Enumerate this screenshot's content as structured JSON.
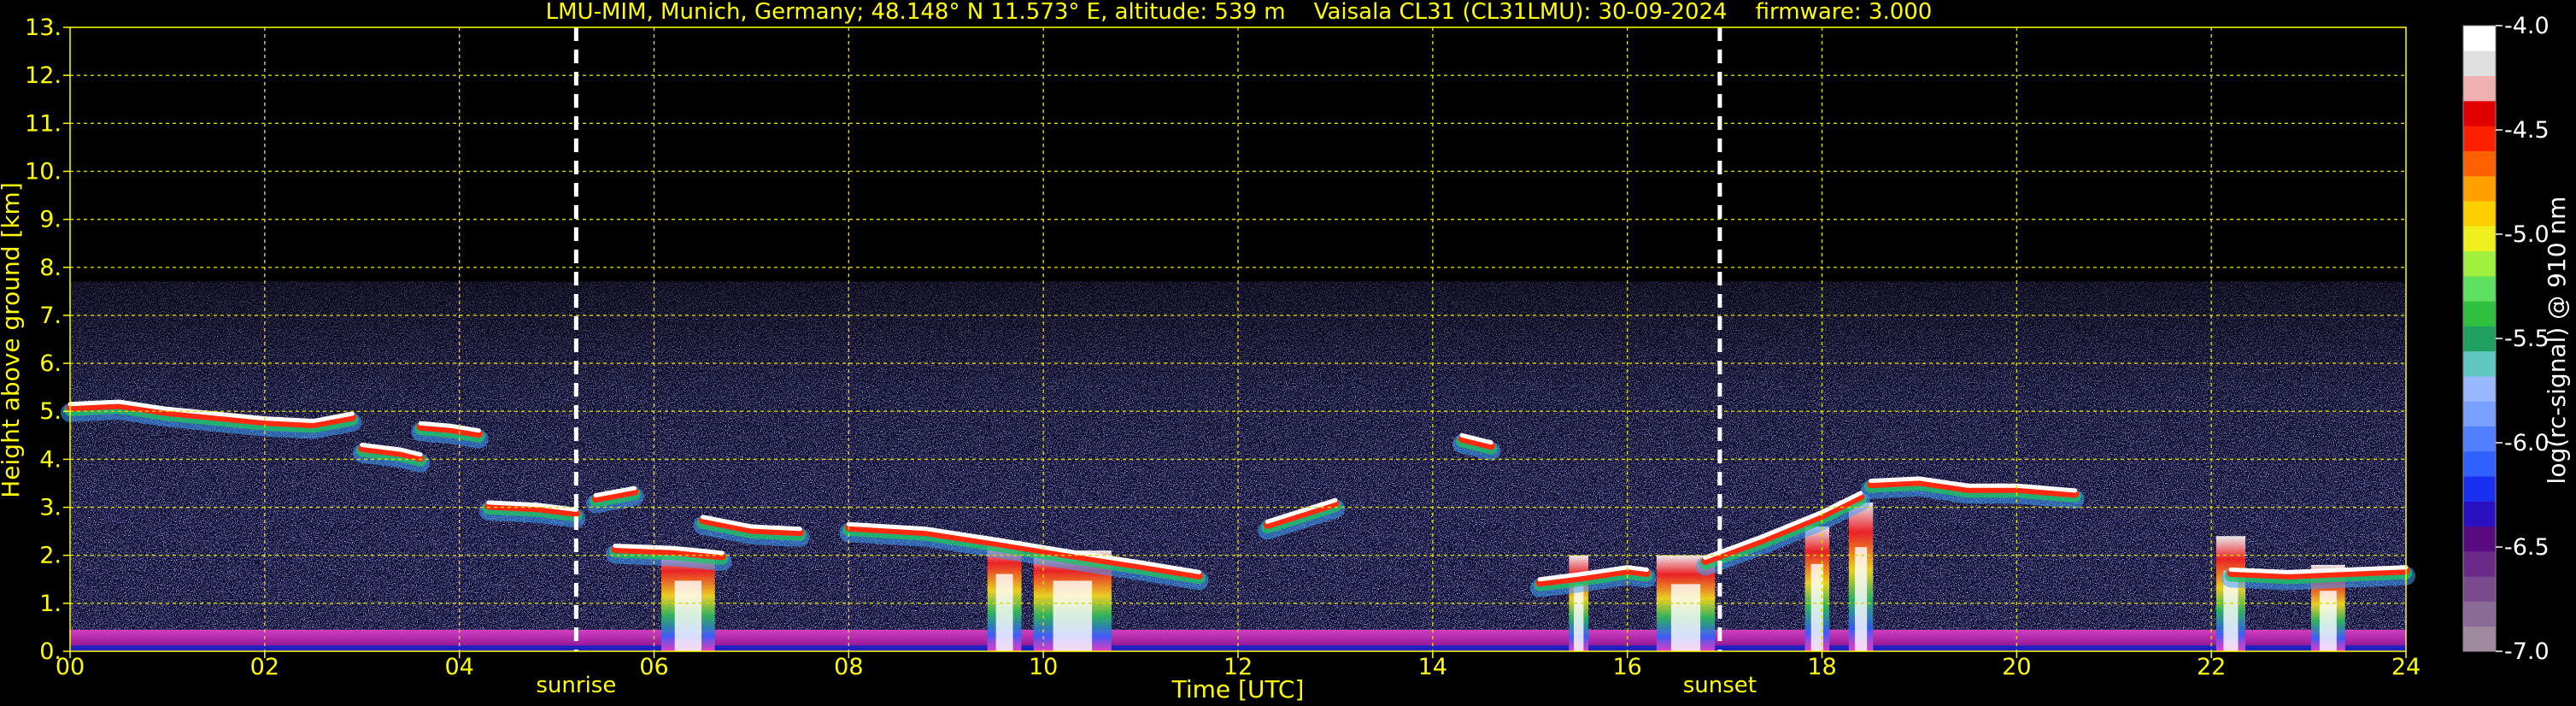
{
  "chart_data": {
    "type": "heatmap",
    "title": "LMU-MIM, Munich, Germany; 48.148° N 11.573° E, altitude: 539 m    Vaisala CL31 (CL31LMU): 30-09-2024    firmware: 3.000",
    "xlabel": "Time [UTC]",
    "ylabel": "Height above ground [km]",
    "xlim": [
      0,
      24
    ],
    "ylim": [
      0,
      13
    ],
    "x_ticks": [
      "00",
      "02",
      "04",
      "06",
      "08",
      "10",
      "12",
      "14",
      "16",
      "18",
      "20",
      "22",
      "24"
    ],
    "y_ticks": [
      "0.",
      "1.",
      "2.",
      "3.",
      "4.",
      "5.",
      "6.",
      "7.",
      "8.",
      "9.",
      "10.",
      "11.",
      "12.",
      "13."
    ],
    "grid": true,
    "signal_max_height_km": 7.7,
    "markers": [
      {
        "label": "sunrise",
        "x": 5.2
      },
      {
        "label": "sunset",
        "x": 16.95
      }
    ],
    "colorbar": {
      "label": "log(rc-signal) @ 910 nm",
      "range": [
        -7.0,
        -4.0
      ],
      "ticks": [
        "-4.0",
        "-4.5",
        "-5.0",
        "-5.5",
        "-6.0",
        "-6.5",
        "-7.0"
      ],
      "colors": [
        "#a08aa0",
        "#8a6a96",
        "#7a4a8e",
        "#6a2a88",
        "#5a0a80",
        "#2a10c0",
        "#1a30f0",
        "#3060ff",
        "#5080ff",
        "#7aa0ff",
        "#9ab8ff",
        "#60c8c0",
        "#20a060",
        "#30c040",
        "#60e060",
        "#a0f040",
        "#f0f020",
        "#ffd000",
        "#ffa000",
        "#ff6000",
        "#ff2000",
        "#e00000",
        "#f0b0b0",
        "#e0e0e0",
        "#ffffff"
      ]
    },
    "cloud_layers": [
      {
        "x": [
          0.0,
          0.5,
          1.0,
          1.5,
          2.0,
          2.5,
          2.9
        ],
        "y": [
          5.15,
          5.2,
          5.05,
          4.95,
          4.85,
          4.8,
          4.95
        ]
      },
      {
        "x": [
          3.0,
          3.4,
          3.6
        ],
        "y": [
          4.3,
          4.2,
          4.1
        ]
      },
      {
        "x": [
          3.6,
          3.9,
          4.2
        ],
        "y": [
          4.75,
          4.7,
          4.6
        ]
      },
      {
        "x": [
          4.3,
          4.8,
          5.2
        ],
        "y": [
          3.1,
          3.05,
          2.95
        ]
      },
      {
        "x": [
          5.4,
          5.8
        ],
        "y": [
          3.25,
          3.4
        ]
      },
      {
        "x": [
          5.6,
          6.2,
          6.7
        ],
        "y": [
          2.2,
          2.15,
          2.05
        ]
      },
      {
        "x": [
          6.5,
          7.0,
          7.5
        ],
        "y": [
          2.8,
          2.6,
          2.55
        ]
      },
      {
        "x": [
          8.0,
          8.8,
          9.6,
          10.2,
          11.0,
          11.6
        ],
        "y": [
          2.65,
          2.55,
          2.3,
          2.1,
          1.85,
          1.65
        ]
      },
      {
        "x": [
          12.3,
          13.0
        ],
        "y": [
          2.7,
          3.15
        ]
      },
      {
        "x": [
          14.3,
          14.6
        ],
        "y": [
          4.5,
          4.35
        ]
      },
      {
        "x": [
          15.1,
          15.5,
          16.0,
          16.2
        ],
        "y": [
          1.5,
          1.6,
          1.75,
          1.7
        ]
      },
      {
        "x": [
          16.8,
          17.4,
          18.0,
          18.4
        ],
        "y": [
          1.95,
          2.4,
          2.9,
          3.3
        ]
      },
      {
        "x": [
          18.5,
          19.0,
          19.5,
          20.0,
          20.6
        ],
        "y": [
          3.55,
          3.6,
          3.45,
          3.45,
          3.35
        ]
      },
      {
        "x": [
          22.2,
          22.8,
          23.4,
          24.0
        ],
        "y": [
          1.7,
          1.65,
          1.7,
          1.75
        ]
      }
    ],
    "fall_streaks": [
      {
        "x": 6.35,
        "top": 2.1,
        "width": 0.55
      },
      {
        "x": 9.6,
        "top": 2.3,
        "width": 0.35
      },
      {
        "x": 10.3,
        "top": 2.1,
        "width": 0.8
      },
      {
        "x": 16.6,
        "top": 2.0,
        "width": 0.6
      },
      {
        "x": 17.95,
        "top": 2.6,
        "width": 0.25
      },
      {
        "x": 18.4,
        "top": 3.1,
        "width": 0.25
      },
      {
        "x": 22.2,
        "top": 2.4,
        "width": 0.3
      },
      {
        "x": 23.2,
        "top": 1.8,
        "width": 0.35
      },
      {
        "x": 15.5,
        "top": 2.0,
        "width": 0.2
      }
    ]
  }
}
